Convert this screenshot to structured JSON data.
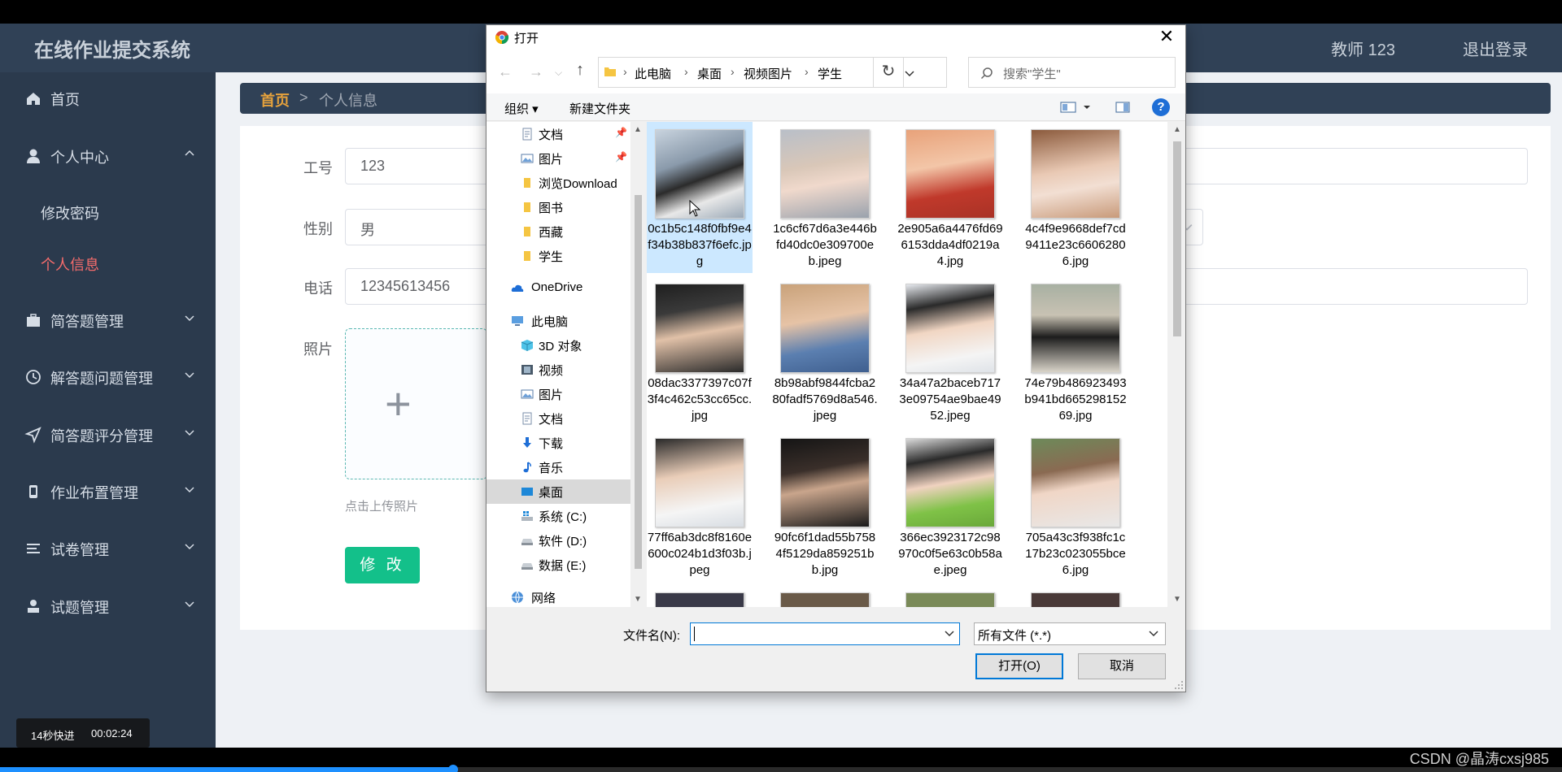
{
  "app": {
    "title": "在线作业提交系统",
    "user_name": "教师 123",
    "logout": "退出登录"
  },
  "sidebar": {
    "items": [
      {
        "label": "首页",
        "icon": "home-icon"
      },
      {
        "label": "个人中心",
        "icon": "user-icon",
        "expanded": true
      },
      {
        "label": "简答题管理",
        "icon": "briefcase-icon"
      },
      {
        "label": "解答题问题管理",
        "icon": "clock-icon"
      },
      {
        "label": "简答题评分管理",
        "icon": "send-icon"
      },
      {
        "label": "作业布置管理",
        "icon": "phone-icon"
      },
      {
        "label": "试卷管理",
        "icon": "list-icon"
      },
      {
        "label": "试题管理",
        "icon": "person-icon"
      }
    ],
    "submenu": [
      {
        "label": "修改密码",
        "active": false
      },
      {
        "label": "个人信息",
        "active": true
      }
    ]
  },
  "breadcrumb": {
    "home": "首页",
    "separator": ">",
    "current": "个人信息"
  },
  "form": {
    "id_label": "工号",
    "id_value": "123",
    "gender_label": "性别",
    "gender_value": "男",
    "phone_label": "电话",
    "phone_value": "12345613456",
    "photo_label": "照片",
    "photo_hint": "点击上传照片",
    "submit_label": "修 改"
  },
  "dialog": {
    "title": "打开",
    "path": [
      "此电脑",
      "桌面",
      "视频图片",
      "学生"
    ],
    "search_placeholder": "搜索\"学生\"",
    "toolbar": {
      "organize": "组织 ▾",
      "new_folder": "新建文件夹",
      "help": "?"
    },
    "nav_items": [
      {
        "label": "文档",
        "icon": "document-icon",
        "pinned": true
      },
      {
        "label": "图片",
        "icon": "picture-icon",
        "pinned": true
      },
      {
        "label": "浏览Download",
        "icon": "folder-icon"
      },
      {
        "label": "图书",
        "icon": "folder-icon"
      },
      {
        "label": "西藏",
        "icon": "folder-icon"
      },
      {
        "label": "学生",
        "icon": "folder-icon"
      },
      {
        "label": "OneDrive",
        "icon": "cloud-icon"
      },
      {
        "label": "此电脑",
        "icon": "computer-icon"
      },
      {
        "label": "3D 对象",
        "icon": "cube-icon"
      },
      {
        "label": "视频",
        "icon": "video-icon"
      },
      {
        "label": "图片",
        "icon": "picture-icon"
      },
      {
        "label": "文档",
        "icon": "document-icon"
      },
      {
        "label": "下载",
        "icon": "download-icon"
      },
      {
        "label": "音乐",
        "icon": "music-icon"
      },
      {
        "label": "桌面",
        "icon": "desktop-icon",
        "selected": true
      },
      {
        "label": "系统 (C:)",
        "icon": "drive-c-icon"
      },
      {
        "label": "软件 (D:)",
        "icon": "drive-icon"
      },
      {
        "label": "数据 (E:)",
        "icon": "drive-icon"
      },
      {
        "label": "网络",
        "icon": "network-icon"
      }
    ],
    "files": [
      {
        "name": "0c1b5c148f0fbf9e4f34b38b837f6efc.jpg",
        "selected": true
      },
      {
        "name": "1c6cf67d6a3e446bfd40dc0e309700eb.jpeg"
      },
      {
        "name": "2e905a6a4476fd696153dda4df0219a4.jpg"
      },
      {
        "name": "4c4f9e9668def7cd9411e23c66062806.jpg"
      },
      {
        "name": "08dac3377397c07f3f4c462c53cc65cc.jpg"
      },
      {
        "name": "8b98abf9844fcba280fadf5769d8a546.jpeg"
      },
      {
        "name": "34a47a2baceb7173e09754ae9bae4952.jpeg"
      },
      {
        "name": "74e79b486923493b941bd66529815269.jpg"
      },
      {
        "name": "77ff6ab3dc8f8160e600c024b1d3f03b.jpeg"
      },
      {
        "name": "90fc6f1dad55b7584f5129da859251bb.jpg"
      },
      {
        "name": "366ec3923172c98970c0f5e63c0b58ae.jpeg"
      },
      {
        "name": "705a43c3f938fc1c17b23c023055bce6.jpg"
      }
    ],
    "file_name_label": "文件名(N):",
    "file_name_value": "",
    "file_type": "所有文件 (*.*)",
    "open_label": "打开(O)",
    "cancel_label": "取消"
  },
  "player": {
    "skip_label": "14秒快进",
    "time": "00:02:24",
    "progress": 0.29
  },
  "watermark": "CSDN @晶涛cxsj985",
  "colors": {
    "header_bg": "#304156",
    "sidebar_bg": "#2b3a4d",
    "accent_red": "#f56c6c",
    "accent_orange": "#e6a23c",
    "primary_green": "#13c08a"
  }
}
